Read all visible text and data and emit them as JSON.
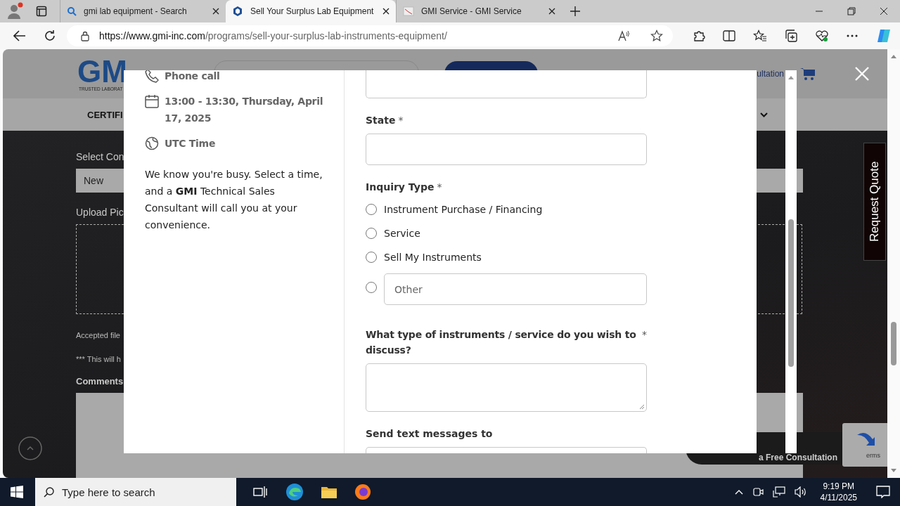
{
  "browser": {
    "tabs": [
      {
        "kind": "search",
        "title": "gmi lab equipment - Search",
        "selected": false
      },
      {
        "kind": "site",
        "title": "Sell Your Surplus Lab Equipment",
        "selected": true
      },
      {
        "kind": "service",
        "title": "GMI Service - GMI Service",
        "selected": false
      }
    ],
    "url_host": "https://www.gmi-inc.com",
    "url_path": "/programs/sell-your-surplus-lab-instruments-equipment/"
  },
  "site": {
    "logo": "GM",
    "tagline": "TRUSTED LABORAT",
    "header_link": "ultation",
    "nav_item": "CERTIFI",
    "condition_label": "Select Con",
    "condition_value": "New",
    "upload_label": "Upload Pic",
    "accepted_note": "Accepted file",
    "hint_note": "*** This will h",
    "comments_label": "Comments",
    "request_quote": "Request Quote",
    "consultation_button": "a Free Consultation",
    "recaptcha_text": "erms"
  },
  "modal": {
    "call_type": "Phone call",
    "datetime": "13:00 - 13:30, Thursday, April 17, 2025",
    "timezone": "UTC Time",
    "description": "We know you're busy. Select a time, and a **GMI** Technical Sales Consultant will call you at your convenience.",
    "form": [
      {
        "kind": "text"
      },
      {
        "kind": "text",
        "label": "State",
        "mark": "*"
      },
      {
        "kind": "radio",
        "label": "Inquiry Type",
        "mark": "*",
        "options": [
          {
            "label": "Instrument Purchase / Financing",
            "selected": false
          },
          {
            "label": "Service",
            "selected": false
          },
          {
            "label": "Sell My Instruments",
            "selected": false
          },
          {
            "placeholder": "Other",
            "selected": false
          }
        ]
      },
      {
        "kind": "textarea",
        "label": "What type of instruments / service do you wish to discuss?",
        "mark": "*"
      },
      {
        "kind": "text",
        "label": "Send text messages to"
      }
    ]
  },
  "taskbar": {
    "search_placeholder": "Type here to search",
    "time": "9:19 PM",
    "date": "4/11/2025"
  }
}
